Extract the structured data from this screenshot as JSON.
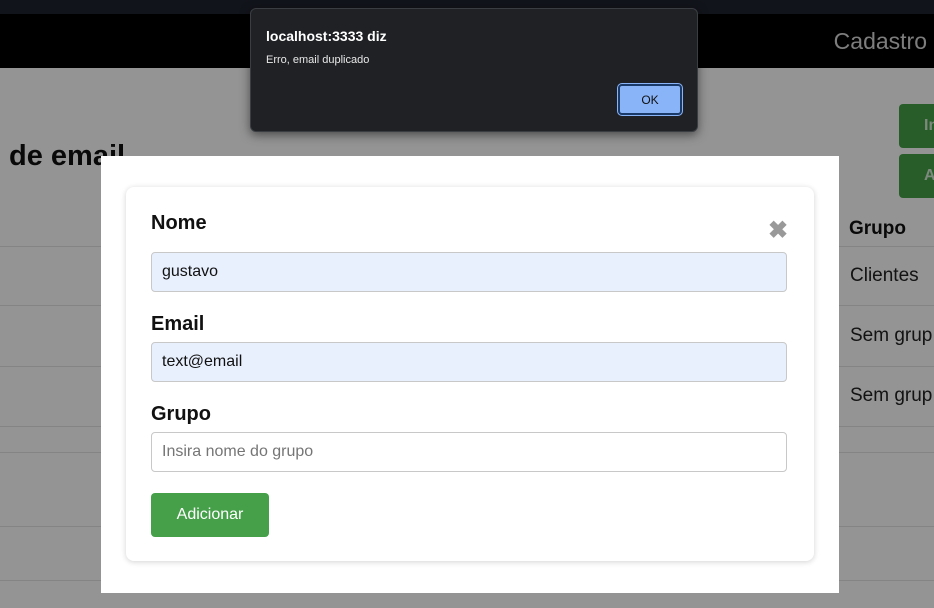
{
  "navbar": {
    "title": "Cadastro"
  },
  "page": {
    "title": "de email"
  },
  "actions": {
    "btn1_label": "In",
    "btn2_label": "A"
  },
  "table": {
    "group_header": "Grupo",
    "rows": [
      {
        "grupo": "Clientes"
      },
      {
        "grupo": "Sem grup"
      },
      {
        "grupo": "Sem grup"
      }
    ]
  },
  "form": {
    "nome_label": "Nome",
    "nome_value": "gustavo",
    "email_label": "Email",
    "email_value": "text@email",
    "grupo_label": "Grupo",
    "grupo_placeholder": "Insira nome do grupo",
    "submit_label": "Adicionar",
    "close_glyph": "✖"
  },
  "dialog": {
    "title": "localhost:3333 diz",
    "message": "Erro, email duplicado",
    "ok_label": "OK"
  },
  "colors": {
    "accent_green": "#45a049",
    "autofill": "#e8f0fe",
    "dialog_bg": "#1f2125",
    "ok_button": "#8ab4f8"
  }
}
